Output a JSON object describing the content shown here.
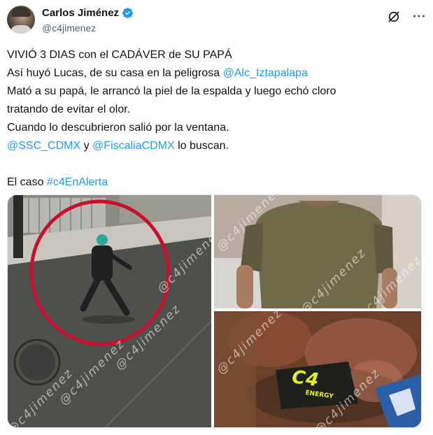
{
  "author": {
    "display_name": "Carlos Jiménez",
    "handle": "@c4jimenez",
    "verified": true,
    "avatar_icon": "avatar-photo"
  },
  "header_icons": {
    "grok": "grok-icon",
    "more": "more-options-icon"
  },
  "tweet": {
    "line1": "VIVIÓ 3 DIAS con el CADÁVER de SU PAPÁ",
    "line2_pre": "Así huyó Lucas, de su casa en la peligrosa ",
    "line2_link": "@Alc_Iztapalapa",
    "line3": "Mató a su papá, le arrancó la piel de la espalda y luego echó cloro",
    "line4": "tratando de evitar el olor.",
    "line5": "Cuando lo descubrieron salió por la ventana.",
    "line6_link1": "@SSC_CDMX",
    "line6_mid": " y ",
    "line6_link2": "@FiscaliaCDMX",
    "line6_post": " lo buscan.",
    "line7_pre": "El caso ",
    "line7_hashtag": "#c4EnAlerta"
  },
  "media": {
    "watermark": "@c4jimenez",
    "logo_main": "C4",
    "logo_sub": "ENERGY"
  },
  "colors": {
    "link": "#1d9bf0",
    "text": "#0f1419",
    "secondary": "#536471",
    "verified": "#1d9bf0",
    "red_circle": "#c8102e"
  }
}
